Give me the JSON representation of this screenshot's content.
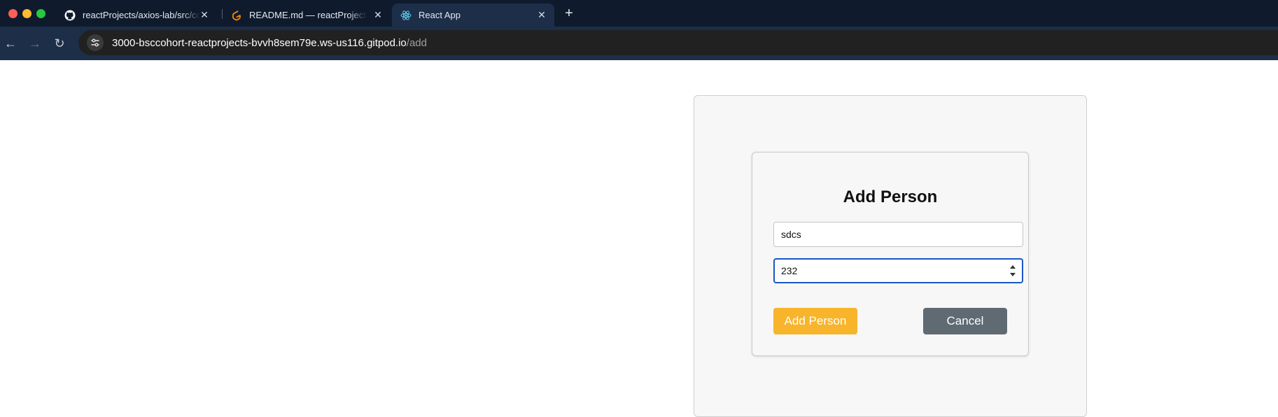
{
  "browser": {
    "tabs": [
      {
        "title": "reactProjects/axios-lab/src/co",
        "icon": "github-icon"
      },
      {
        "title": "README.md — reactProjects",
        "icon": "gitpod-icon"
      },
      {
        "title": "React App",
        "icon": "react-icon",
        "active": true
      }
    ],
    "url": {
      "host": "3000-bsccohort-reactprojects-bvvh8sem79e.ws-us116.gitpod.io",
      "path": "/add"
    }
  },
  "form": {
    "title": "Add Person",
    "name_value": "sdcs",
    "age_value": "232",
    "submit_label": "Add Person",
    "cancel_label": "Cancel"
  },
  "colors": {
    "submit": "#f8b42a",
    "cancel": "#606a72",
    "focus": "#1b56c8"
  }
}
